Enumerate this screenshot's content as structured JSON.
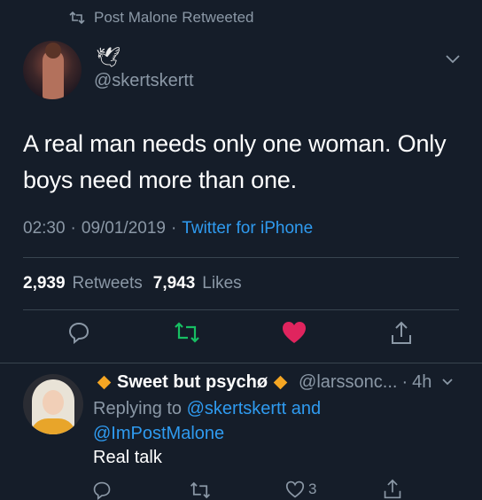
{
  "header": {
    "retweet_label": "Post Malone Retweeted"
  },
  "tweet": {
    "user_name_emoji": "🕊",
    "handle": "@skertskertt",
    "text": "A real man needs only one woman. Only boys need more than one.",
    "time": "02:30",
    "date": "09/01/2019",
    "source": "Twitter for iPhone",
    "retweets_count": "2,939",
    "retweets_label": "Retweets",
    "likes_count": "7,943",
    "likes_label": "Likes",
    "liked": true,
    "like_color": "#e0245e",
    "retweet_color": "#17bf63"
  },
  "reply": {
    "name": "Sweet but psychø",
    "handle": "@larssonc...",
    "time_ago": "4h",
    "replying_prefix": "Replying to",
    "replying_to_1": "@skertskertt",
    "replying_and": "and",
    "replying_to_2": "@ImPostMalone",
    "text": "Real talk",
    "likes_count": "3"
  },
  "colors": {
    "background": "#151d29",
    "muted": "#8b98a6",
    "link": "#2f9bf0",
    "badge": "#f5a623"
  }
}
